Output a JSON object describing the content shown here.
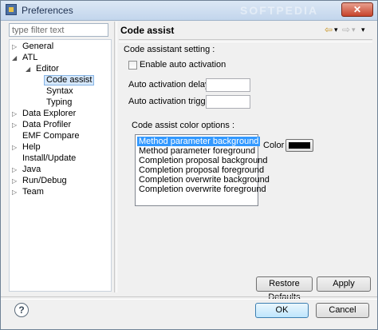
{
  "window": {
    "title": "Preferences",
    "close_label": "✕",
    "watermark": "SOFTPEDIA"
  },
  "filter": {
    "placeholder": "type filter text"
  },
  "tree": [
    {
      "label": "General",
      "twisty": "▷"
    },
    {
      "label": "ATL",
      "twisty": "◢"
    },
    {
      "label": "Editor",
      "twisty": "◢"
    },
    {
      "label": "Code assist",
      "twisty": "",
      "selected": true
    },
    {
      "label": "Syntax",
      "twisty": ""
    },
    {
      "label": "Typing",
      "twisty": ""
    },
    {
      "label": "Data Explorer",
      "twisty": "▷"
    },
    {
      "label": "Data Profiler",
      "twisty": "▷"
    },
    {
      "label": "EMF Compare",
      "twisty": ""
    },
    {
      "label": "Help",
      "twisty": "▷"
    },
    {
      "label": "Install/Update",
      "twisty": ""
    },
    {
      "label": "Java",
      "twisty": "▷"
    },
    {
      "label": "Run/Debug",
      "twisty": "▷"
    },
    {
      "label": "Team",
      "twisty": "▷"
    }
  ],
  "page": {
    "title": "Code assist",
    "nav": {
      "back": "⇦",
      "back_menu": "▾",
      "forward": "⇨",
      "forward_menu": "▾",
      "view_menu": "▾"
    },
    "settings_label": "Code assistant setting :",
    "auto_activation_label": "Enable auto activation",
    "delay_label": "Auto activation delay",
    "triggers_label": "Auto activation triggers",
    "color_options_label": "Code assist color options :",
    "color_items": [
      "Method parameter background",
      "Method parameter foreground",
      "Completion proposal background",
      "Completion proposal foreground",
      "Completion overwrite background",
      "Completion overwrite foreground"
    ],
    "color_label": "Color",
    "color_value": "#000000",
    "restore_defaults": "Restore Defaults",
    "apply": "Apply"
  },
  "footer": {
    "help": "?",
    "ok": "OK",
    "cancel": "Cancel"
  }
}
